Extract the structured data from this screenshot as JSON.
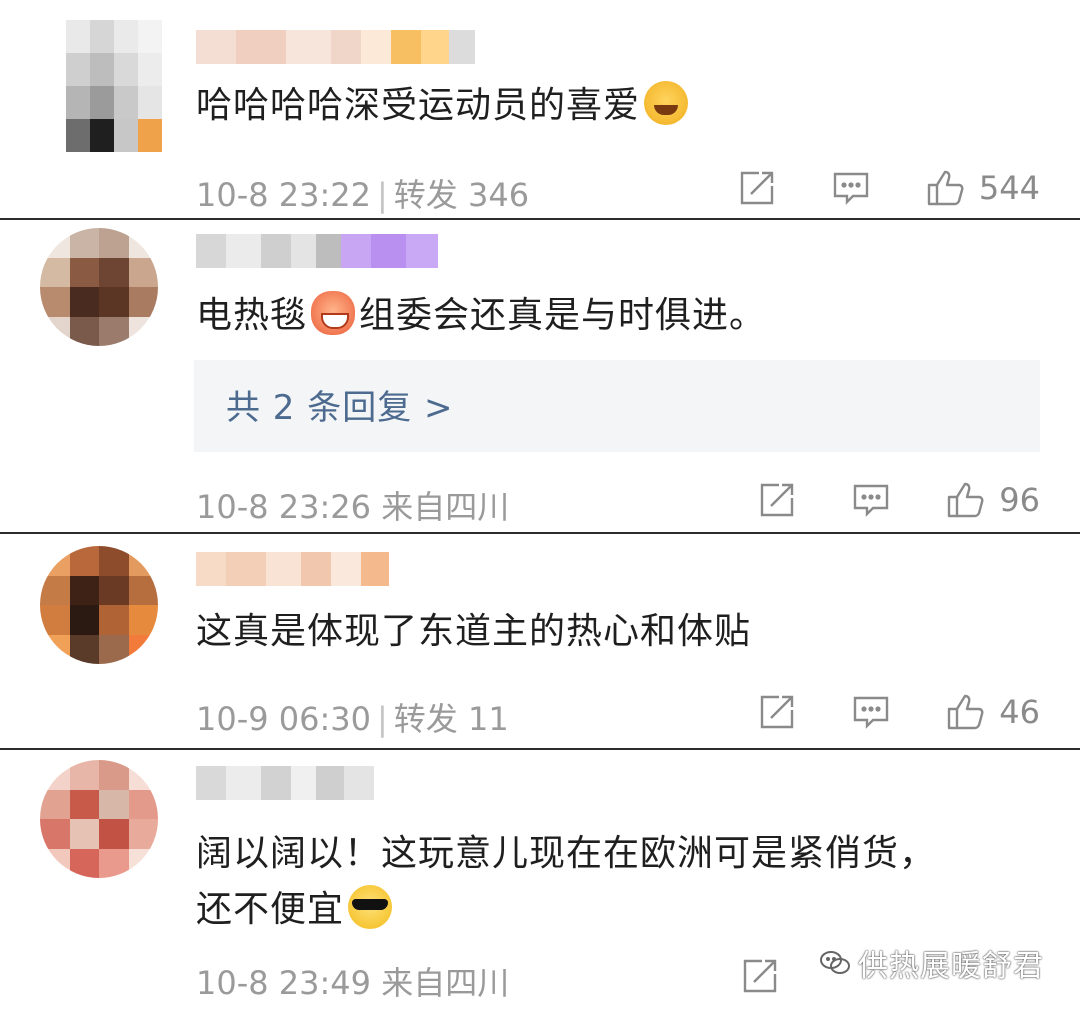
{
  "comments": [
    {
      "text": "哈哈哈哈深受运动员的喜爱",
      "emoji": "laughing-tears-emoji",
      "time": "10-8 23:22",
      "sep": "|",
      "meta_extra": "转发 346",
      "likes": "544"
    },
    {
      "text_before": "电热毯",
      "emoji": "happy-face-emoji",
      "text_after": "组委会还真是与时俱进。",
      "reply_link": "共 2 条回复 >",
      "time": "10-8 23:26",
      "meta_extra": "来自四川",
      "likes": "96"
    },
    {
      "text": "这真是体现了东道主的热心和体贴",
      "time": "10-9 06:30",
      "sep": "|",
      "meta_extra": "转发 11",
      "likes": "46"
    },
    {
      "text_line1": "阔以阔以！这玩意儿现在在欧洲可是紧俏货，",
      "text_line2": "还不便宜",
      "emoji": "sunglasses-emoji",
      "time": "10-8 23:49",
      "meta_extra": "来自四川"
    }
  ],
  "icons": {
    "share": "share-icon",
    "comment": "comment-icon",
    "like": "thumbs-up-icon"
  },
  "watermark": {
    "text": "供热展暖舒君",
    "icon": "wechat-icon"
  },
  "colors": {
    "link": "#4d6a8f",
    "meta": "#9a9a9a",
    "reply_bg": "#f3f5f7"
  }
}
